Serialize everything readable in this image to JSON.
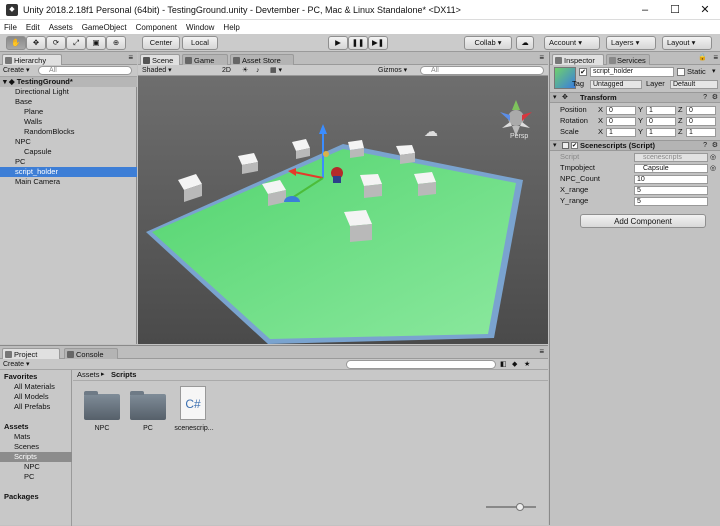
{
  "window": {
    "title": "Unity 2018.2.18f1 Personal (64bit) - TestingGround.unity - Devtember - PC, Mac & Linux Standalone* <DX11>"
  },
  "menu": [
    "File",
    "Edit",
    "Assets",
    "GameObject",
    "Component",
    "Window",
    "Help"
  ],
  "toolbar": {
    "center": "Center",
    "local": "Local",
    "collab": "Collab",
    "account": "Account",
    "layers": "Layers",
    "layout": "Layout"
  },
  "hierarchy": {
    "tab": "Hierarchy",
    "create": "Create",
    "search_placeholder": "All",
    "scene": "TestingGround*",
    "items": [
      {
        "label": "Directional Light",
        "indent": 1
      },
      {
        "label": "Base",
        "indent": 1
      },
      {
        "label": "Plane",
        "indent": 2
      },
      {
        "label": "Walls",
        "indent": 2
      },
      {
        "label": "RandomBlocks",
        "indent": 2
      },
      {
        "label": "NPC",
        "indent": 1
      },
      {
        "label": "Capsule",
        "indent": 2
      },
      {
        "label": "PC",
        "indent": 1
      },
      {
        "label": "script_holder",
        "indent": 1
      },
      {
        "label": "Main Camera",
        "indent": 1
      }
    ]
  },
  "scene": {
    "tabs": [
      "Scene",
      "Game",
      "Asset Store"
    ],
    "shading": "Shaded",
    "mode2d": "2D",
    "gizmos": "Gizmos",
    "search_placeholder": "All",
    "persp": "Persp"
  },
  "inspector": {
    "tabs": [
      "Inspector",
      "Services"
    ],
    "object_name": "script_holder",
    "static_label": "Static",
    "tag_label": "Tag",
    "tag_value": "Untagged",
    "layer_label": "Layer",
    "layer_value": "Default",
    "transform": {
      "title": "Transform",
      "rows": [
        {
          "label": "Position",
          "x": "0",
          "y": "1",
          "z": "0"
        },
        {
          "label": "Rotation",
          "x": "0",
          "y": "0",
          "z": "0"
        },
        {
          "label": "Scale",
          "x": "1",
          "y": "1",
          "z": "1"
        }
      ],
      "axis": [
        "X",
        "Y",
        "Z"
      ]
    },
    "script": {
      "title": "Scenescripts (Script)",
      "fields": [
        {
          "label": "Script",
          "value": "scenescripts"
        },
        {
          "label": "Tmpobject",
          "value": "Capsule"
        },
        {
          "label": "NPC_Count",
          "value": "10"
        },
        {
          "label": "X_range",
          "value": "5"
        },
        {
          "label": "Y_range",
          "value": "5"
        }
      ]
    },
    "add_component": "Add Component"
  },
  "project": {
    "tabs": [
      "Project",
      "Console"
    ],
    "create": "Create",
    "tree": [
      {
        "label": "Favorites",
        "indent": 0,
        "bold": true
      },
      {
        "label": "All Materials",
        "indent": 1
      },
      {
        "label": "All Models",
        "indent": 1
      },
      {
        "label": "All Prefabs",
        "indent": 1
      },
      {
        "label": "",
        "indent": 0
      },
      {
        "label": "Assets",
        "indent": 0,
        "bold": true
      },
      {
        "label": "Mats",
        "indent": 1
      },
      {
        "label": "Scenes",
        "indent": 1
      },
      {
        "label": "Scripts",
        "indent": 1,
        "selected": true
      },
      {
        "label": "NPC",
        "indent": 2
      },
      {
        "label": "PC",
        "indent": 2
      },
      {
        "label": "",
        "indent": 0
      },
      {
        "label": "Packages",
        "indent": 0,
        "bold": true
      }
    ],
    "breadcrumb": [
      "Assets",
      "Scripts"
    ],
    "assets": [
      {
        "name": "NPC",
        "kind": "folder"
      },
      {
        "name": "PC",
        "kind": "folder"
      },
      {
        "name": "scenescrip...",
        "kind": "csharp",
        "glyph": "C#"
      }
    ]
  },
  "colors": {
    "selection": "#3d7ed6",
    "floor": "#5fd97a",
    "wall": "#7aa3cf",
    "skybox": "#5a5a5a"
  }
}
